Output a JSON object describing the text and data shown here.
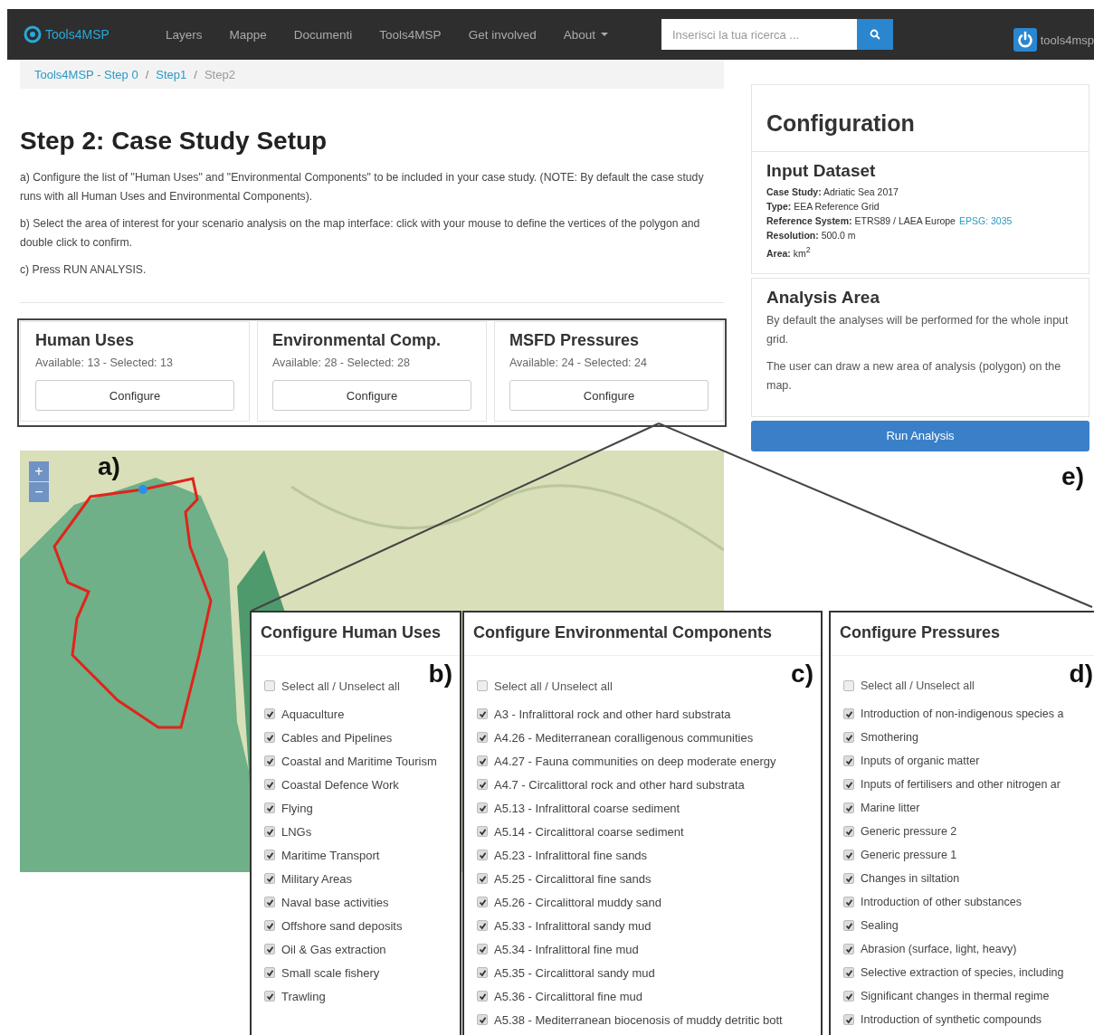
{
  "navbar": {
    "brand": "Tools4MSP",
    "items": [
      {
        "label": "Layers",
        "dropdown": false
      },
      {
        "label": "Mappe",
        "dropdown": false
      },
      {
        "label": "Documenti",
        "dropdown": false
      },
      {
        "label": "Tools4MSP",
        "dropdown": false
      },
      {
        "label": "Get involved",
        "dropdown": false
      },
      {
        "label": "About",
        "dropdown": true
      }
    ],
    "search": {
      "placeholder": "Inserisci la tua ricerca ..."
    },
    "user": "tools4msp"
  },
  "breadcrumb": [
    {
      "label": "Tools4MSP - Step 0",
      "link": true
    },
    {
      "label": "Step1",
      "link": true,
      "separator": "/"
    },
    {
      "label": "Step2",
      "link": false,
      "separator": "/"
    }
  ],
  "title": "Step 2: Case Study Setup",
  "instructions": [
    "a) Configure the list of \"Human Uses\" and \"Environmental Components\" to be included in your case study. (NOTE: By default the case study runs with all Human Uses and Environmental Components).",
    "b) Select the area of interest for your scenario analysis on the map interface: click with your mouse to define the vertices of the polygon and double click to confirm.",
    "c) Press RUN ANALYSIS."
  ],
  "cards": [
    {
      "title": "Human Uses",
      "stats": "Available: 13 - Selected: 13",
      "button": "Configure"
    },
    {
      "title": "Environmental Comp.",
      "stats": "Available: 28 - Selected: 28",
      "button": "Configure"
    },
    {
      "title": "MSFD Pressures",
      "stats": "Available: 24 - Selected: 24",
      "button": "Configure"
    }
  ],
  "map": {
    "figure_label": "a)",
    "zoom_in": "+",
    "zoom_out": "−"
  },
  "configuration": {
    "title": "Configuration",
    "input_dataset": {
      "title": "Input Dataset",
      "fields": [
        {
          "text": "**Case Study:** Adriatic Sea 2017"
        },
        {
          "text": "**Type:** EEA Reference Grid"
        },
        {
          "text": "**Reference System:** ETRS89 / LAEA Europe",
          "link": "EPSG: 3035"
        },
        {
          "text": "**Resolution:** 500.0 m"
        },
        {
          "text": "**Area:** km$^{2}$"
        }
      ]
    },
    "analysis_area": {
      "title": "Analysis Area",
      "paragraphs": [
        "By default the analyses will be performed for the whole input grid.",
        "The user can draw a new area of analysis (polygon) on the map."
      ]
    },
    "run_button": "Run Analysis",
    "figure_label": "e)"
  },
  "panels": [
    {
      "title": "Configure Human Uses",
      "figure_label": "b)",
      "select_all": {
        "label": "Select all / Unselect all",
        "checked": false
      },
      "items": [
        {
          "label": "Aquaculture",
          "checked": true
        },
        {
          "label": "Cables and Pipelines",
          "checked": true
        },
        {
          "label": "Coastal and Maritime Tourism",
          "checked": true
        },
        {
          "label": "Coastal Defence Work",
          "checked": true
        },
        {
          "label": "Flying",
          "checked": true
        },
        {
          "label": "LNGs",
          "checked": true
        },
        {
          "label": "Maritime Transport",
          "checked": true
        },
        {
          "label": "Military Areas",
          "checked": true
        },
        {
          "label": "Naval base activities",
          "checked": true
        },
        {
          "label": "Offshore sand deposits",
          "checked": true
        },
        {
          "label": "Oil & Gas extraction",
          "checked": true
        },
        {
          "label": "Small scale fishery",
          "checked": true
        },
        {
          "label": "Trawling",
          "checked": true
        }
      ]
    },
    {
      "title": "Configure Environmental Components",
      "figure_label": "c)",
      "select_all": {
        "label": "Select all / Unselect all",
        "checked": false
      },
      "items": [
        {
          "label": "A3 - Infralittoral rock and other hard substrata",
          "checked": true
        },
        {
          "label": "A4.26 - Mediterranean coralligenous communities",
          "checked": true
        },
        {
          "label": "A4.27 - Fauna communities on deep moderate energy",
          "checked": true
        },
        {
          "label": "A4.7 - Circalittoral rock and other hard substrata",
          "checked": true
        },
        {
          "label": "A5.13 - Infralittoral coarse sediment",
          "checked": true
        },
        {
          "label": "A5.14 - Circalittoral coarse sediment",
          "checked": true
        },
        {
          "label": "A5.23 - Infralittoral fine sands",
          "checked": true
        },
        {
          "label": "A5.25 - Circalittoral fine sands",
          "checked": true
        },
        {
          "label": "A5.26 - Circalittoral muddy sand",
          "checked": true
        },
        {
          "label": "A5.33 - Infralittoral sandy mud",
          "checked": true
        },
        {
          "label": "A5.34 - Infralittoral fine mud",
          "checked": true
        },
        {
          "label": "A5.35 - Circalittoral sandy mud",
          "checked": true
        },
        {
          "label": "A5.36 - Circalittoral fine mud",
          "checked": true
        },
        {
          "label": "A5.38 - Mediterranean biocenosis of muddy detritic bott",
          "checked": true
        }
      ]
    },
    {
      "title": "Configure Pressures",
      "figure_label": "d)",
      "select_all": {
        "label": "Select all / Unselect all",
        "checked": false
      },
      "items": [
        {
          "label": "Introduction of non-indigenous species a",
          "checked": true
        },
        {
          "label": "Smothering",
          "checked": true
        },
        {
          "label": "Inputs of organic matter",
          "checked": true
        },
        {
          "label": "Inputs of fertilisers and other nitrogen ar",
          "checked": true
        },
        {
          "label": "Marine litter",
          "checked": true
        },
        {
          "label": "Generic pressure 2",
          "checked": true
        },
        {
          "label": "Generic pressure 1",
          "checked": true
        },
        {
          "label": "Changes in siltation",
          "checked": true
        },
        {
          "label": "Introduction of other substances",
          "checked": true
        },
        {
          "label": "Sealing",
          "checked": true
        },
        {
          "label": "Abrasion (surface, light, heavy)",
          "checked": true
        },
        {
          "label": "Selective extraction of species, including",
          "checked": true
        },
        {
          "label": "Significant changes in thermal regime",
          "checked": true
        },
        {
          "label": "Introduction of synthetic compounds",
          "checked": true
        }
      ]
    }
  ]
}
